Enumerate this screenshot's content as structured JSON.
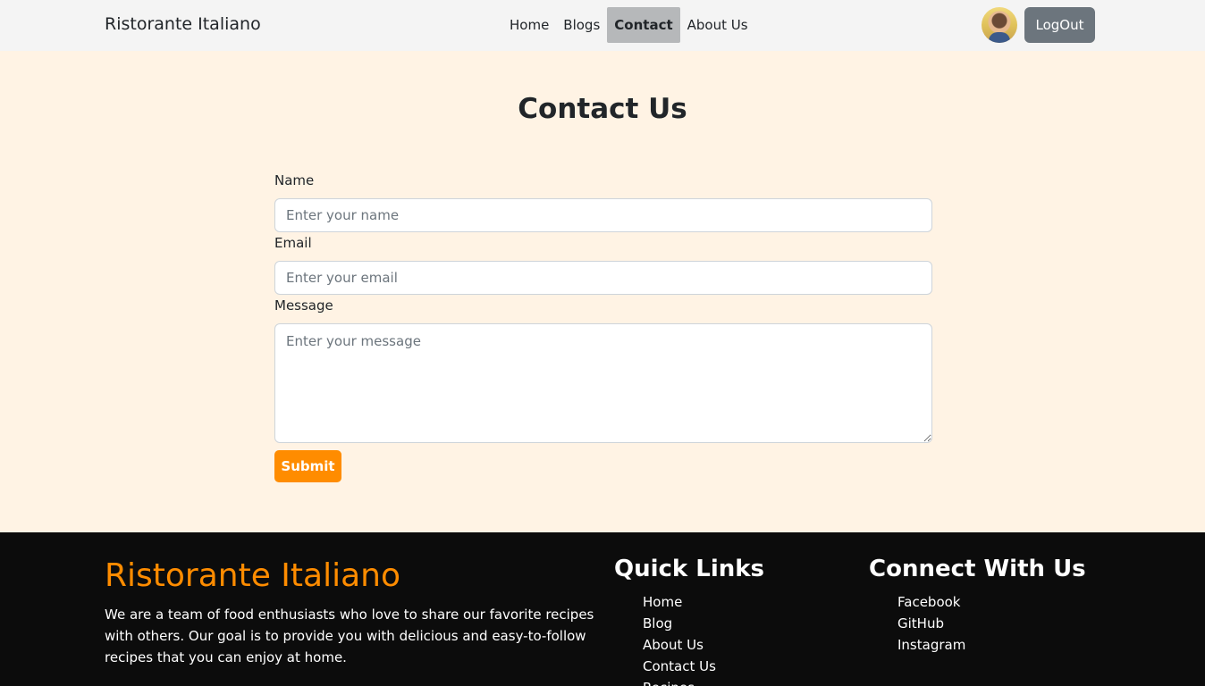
{
  "navbar": {
    "brand": "Ristorante Italiano",
    "links": [
      {
        "label": "Home"
      },
      {
        "label": "Blogs"
      },
      {
        "label": "Contact",
        "active": true
      },
      {
        "label": "About Us"
      }
    ],
    "logout_label": "LogOut"
  },
  "main": {
    "title": "Contact Us",
    "form": {
      "name_label": "Name",
      "name_placeholder": "Enter your name",
      "email_label": "Email",
      "email_placeholder": "Enter your email",
      "message_label": "Message",
      "message_placeholder": "Enter your message",
      "submit_label": "Submit"
    }
  },
  "footer": {
    "brand": "Ristorante Italiano",
    "description": "We are a team of food enthusiasts who love to share our favorite recipes with others. Our goal is to provide you with delicious and easy-to-follow recipes that you can enjoy at home.",
    "quick_links": {
      "heading": "Quick Links",
      "items": [
        "Home",
        "Blog",
        "About Us",
        "Contact Us",
        "Recipes"
      ]
    },
    "connect": {
      "heading": "Connect With Us",
      "items": [
        "Facebook",
        "GitHub",
        "Instagram"
      ]
    }
  },
  "colors": {
    "accent": "#ff8c00",
    "page_background": "#fff3e4",
    "navbar_background": "#f4f4f4",
    "footer_background": "#0c0c0c",
    "logout_button": "#6c757d"
  }
}
